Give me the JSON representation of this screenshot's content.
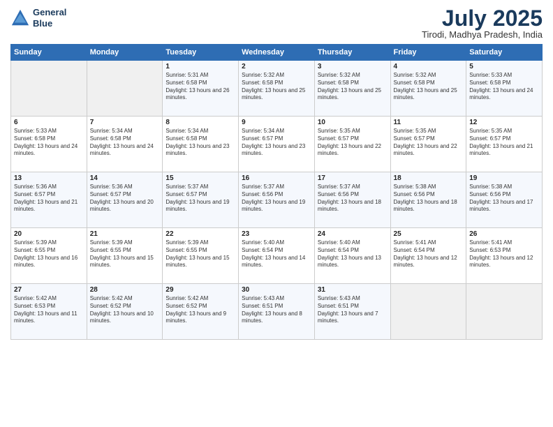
{
  "header": {
    "logo_line1": "General",
    "logo_line2": "Blue",
    "month": "July 2025",
    "location": "Tirodi, Madhya Pradesh, India"
  },
  "weekdays": [
    "Sunday",
    "Monday",
    "Tuesday",
    "Wednesday",
    "Thursday",
    "Friday",
    "Saturday"
  ],
  "weeks": [
    [
      {
        "num": "",
        "sunrise": "",
        "sunset": "",
        "daylight": "",
        "empty": true
      },
      {
        "num": "",
        "sunrise": "",
        "sunset": "",
        "daylight": "",
        "empty": true
      },
      {
        "num": "1",
        "sunrise": "Sunrise: 5:31 AM",
        "sunset": "Sunset: 6:58 PM",
        "daylight": "Daylight: 13 hours and 26 minutes.",
        "empty": false
      },
      {
        "num": "2",
        "sunrise": "Sunrise: 5:32 AM",
        "sunset": "Sunset: 6:58 PM",
        "daylight": "Daylight: 13 hours and 25 minutes.",
        "empty": false
      },
      {
        "num": "3",
        "sunrise": "Sunrise: 5:32 AM",
        "sunset": "Sunset: 6:58 PM",
        "daylight": "Daylight: 13 hours and 25 minutes.",
        "empty": false
      },
      {
        "num": "4",
        "sunrise": "Sunrise: 5:32 AM",
        "sunset": "Sunset: 6:58 PM",
        "daylight": "Daylight: 13 hours and 25 minutes.",
        "empty": false
      },
      {
        "num": "5",
        "sunrise": "Sunrise: 5:33 AM",
        "sunset": "Sunset: 6:58 PM",
        "daylight": "Daylight: 13 hours and 24 minutes.",
        "empty": false
      }
    ],
    [
      {
        "num": "6",
        "sunrise": "Sunrise: 5:33 AM",
        "sunset": "Sunset: 6:58 PM",
        "daylight": "Daylight: 13 hours and 24 minutes.",
        "empty": false
      },
      {
        "num": "7",
        "sunrise": "Sunrise: 5:34 AM",
        "sunset": "Sunset: 6:58 PM",
        "daylight": "Daylight: 13 hours and 24 minutes.",
        "empty": false
      },
      {
        "num": "8",
        "sunrise": "Sunrise: 5:34 AM",
        "sunset": "Sunset: 6:58 PM",
        "daylight": "Daylight: 13 hours and 23 minutes.",
        "empty": false
      },
      {
        "num": "9",
        "sunrise": "Sunrise: 5:34 AM",
        "sunset": "Sunset: 6:57 PM",
        "daylight": "Daylight: 13 hours and 23 minutes.",
        "empty": false
      },
      {
        "num": "10",
        "sunrise": "Sunrise: 5:35 AM",
        "sunset": "Sunset: 6:57 PM",
        "daylight": "Daylight: 13 hours and 22 minutes.",
        "empty": false
      },
      {
        "num": "11",
        "sunrise": "Sunrise: 5:35 AM",
        "sunset": "Sunset: 6:57 PM",
        "daylight": "Daylight: 13 hours and 22 minutes.",
        "empty": false
      },
      {
        "num": "12",
        "sunrise": "Sunrise: 5:35 AM",
        "sunset": "Sunset: 6:57 PM",
        "daylight": "Daylight: 13 hours and 21 minutes.",
        "empty": false
      }
    ],
    [
      {
        "num": "13",
        "sunrise": "Sunrise: 5:36 AM",
        "sunset": "Sunset: 6:57 PM",
        "daylight": "Daylight: 13 hours and 21 minutes.",
        "empty": false
      },
      {
        "num": "14",
        "sunrise": "Sunrise: 5:36 AM",
        "sunset": "Sunset: 6:57 PM",
        "daylight": "Daylight: 13 hours and 20 minutes.",
        "empty": false
      },
      {
        "num": "15",
        "sunrise": "Sunrise: 5:37 AM",
        "sunset": "Sunset: 6:57 PM",
        "daylight": "Daylight: 13 hours and 19 minutes.",
        "empty": false
      },
      {
        "num": "16",
        "sunrise": "Sunrise: 5:37 AM",
        "sunset": "Sunset: 6:56 PM",
        "daylight": "Daylight: 13 hours and 19 minutes.",
        "empty": false
      },
      {
        "num": "17",
        "sunrise": "Sunrise: 5:37 AM",
        "sunset": "Sunset: 6:56 PM",
        "daylight": "Daylight: 13 hours and 18 minutes.",
        "empty": false
      },
      {
        "num": "18",
        "sunrise": "Sunrise: 5:38 AM",
        "sunset": "Sunset: 6:56 PM",
        "daylight": "Daylight: 13 hours and 18 minutes.",
        "empty": false
      },
      {
        "num": "19",
        "sunrise": "Sunrise: 5:38 AM",
        "sunset": "Sunset: 6:56 PM",
        "daylight": "Daylight: 13 hours and 17 minutes.",
        "empty": false
      }
    ],
    [
      {
        "num": "20",
        "sunrise": "Sunrise: 5:39 AM",
        "sunset": "Sunset: 6:55 PM",
        "daylight": "Daylight: 13 hours and 16 minutes.",
        "empty": false
      },
      {
        "num": "21",
        "sunrise": "Sunrise: 5:39 AM",
        "sunset": "Sunset: 6:55 PM",
        "daylight": "Daylight: 13 hours and 15 minutes.",
        "empty": false
      },
      {
        "num": "22",
        "sunrise": "Sunrise: 5:39 AM",
        "sunset": "Sunset: 6:55 PM",
        "daylight": "Daylight: 13 hours and 15 minutes.",
        "empty": false
      },
      {
        "num": "23",
        "sunrise": "Sunrise: 5:40 AM",
        "sunset": "Sunset: 6:54 PM",
        "daylight": "Daylight: 13 hours and 14 minutes.",
        "empty": false
      },
      {
        "num": "24",
        "sunrise": "Sunrise: 5:40 AM",
        "sunset": "Sunset: 6:54 PM",
        "daylight": "Daylight: 13 hours and 13 minutes.",
        "empty": false
      },
      {
        "num": "25",
        "sunrise": "Sunrise: 5:41 AM",
        "sunset": "Sunset: 6:54 PM",
        "daylight": "Daylight: 13 hours and 12 minutes.",
        "empty": false
      },
      {
        "num": "26",
        "sunrise": "Sunrise: 5:41 AM",
        "sunset": "Sunset: 6:53 PM",
        "daylight": "Daylight: 13 hours and 12 minutes.",
        "empty": false
      }
    ],
    [
      {
        "num": "27",
        "sunrise": "Sunrise: 5:42 AM",
        "sunset": "Sunset: 6:53 PM",
        "daylight": "Daylight: 13 hours and 11 minutes.",
        "empty": false
      },
      {
        "num": "28",
        "sunrise": "Sunrise: 5:42 AM",
        "sunset": "Sunset: 6:52 PM",
        "daylight": "Daylight: 13 hours and 10 minutes.",
        "empty": false
      },
      {
        "num": "29",
        "sunrise": "Sunrise: 5:42 AM",
        "sunset": "Sunset: 6:52 PM",
        "daylight": "Daylight: 13 hours and 9 minutes.",
        "empty": false
      },
      {
        "num": "30",
        "sunrise": "Sunrise: 5:43 AM",
        "sunset": "Sunset: 6:51 PM",
        "daylight": "Daylight: 13 hours and 8 minutes.",
        "empty": false
      },
      {
        "num": "31",
        "sunrise": "Sunrise: 5:43 AM",
        "sunset": "Sunset: 6:51 PM",
        "daylight": "Daylight: 13 hours and 7 minutes.",
        "empty": false
      },
      {
        "num": "",
        "sunrise": "",
        "sunset": "",
        "daylight": "",
        "empty": true
      },
      {
        "num": "",
        "sunrise": "",
        "sunset": "",
        "daylight": "",
        "empty": true
      }
    ]
  ]
}
